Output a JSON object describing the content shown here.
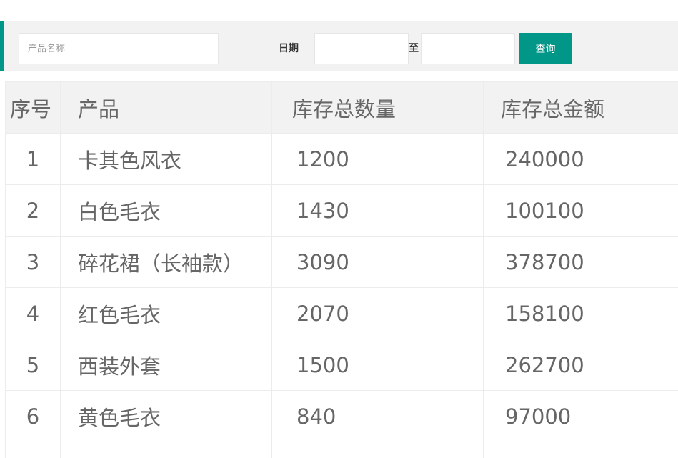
{
  "filter": {
    "product_name_placeholder": "产品名称",
    "date_label": "日期",
    "to_label": "至",
    "query_button": "查询",
    "date_start_value": "",
    "date_end_value": ""
  },
  "table": {
    "headers": [
      "序号",
      "产品",
      "库存总数量",
      "库存总金额"
    ],
    "rows": [
      {
        "index": "1",
        "product": "卡其色风衣",
        "quantity": "1200",
        "amount": "240000"
      },
      {
        "index": "2",
        "product": "白色毛衣",
        "quantity": "1430",
        "amount": "100100"
      },
      {
        "index": "3",
        "product": "碎花裙（长袖款）",
        "quantity": "3090",
        "amount": "378700"
      },
      {
        "index": "4",
        "product": "红色毛衣",
        "quantity": "2070",
        "amount": "158100"
      },
      {
        "index": "5",
        "product": "西装外套",
        "quantity": "1500",
        "amount": "262700"
      },
      {
        "index": "6",
        "product": "黄色毛衣",
        "quantity": "840",
        "amount": "97000"
      }
    ]
  },
  "colors": {
    "accent": "#009688",
    "bar_background": "#f2f2f2",
    "text": "#666666"
  }
}
